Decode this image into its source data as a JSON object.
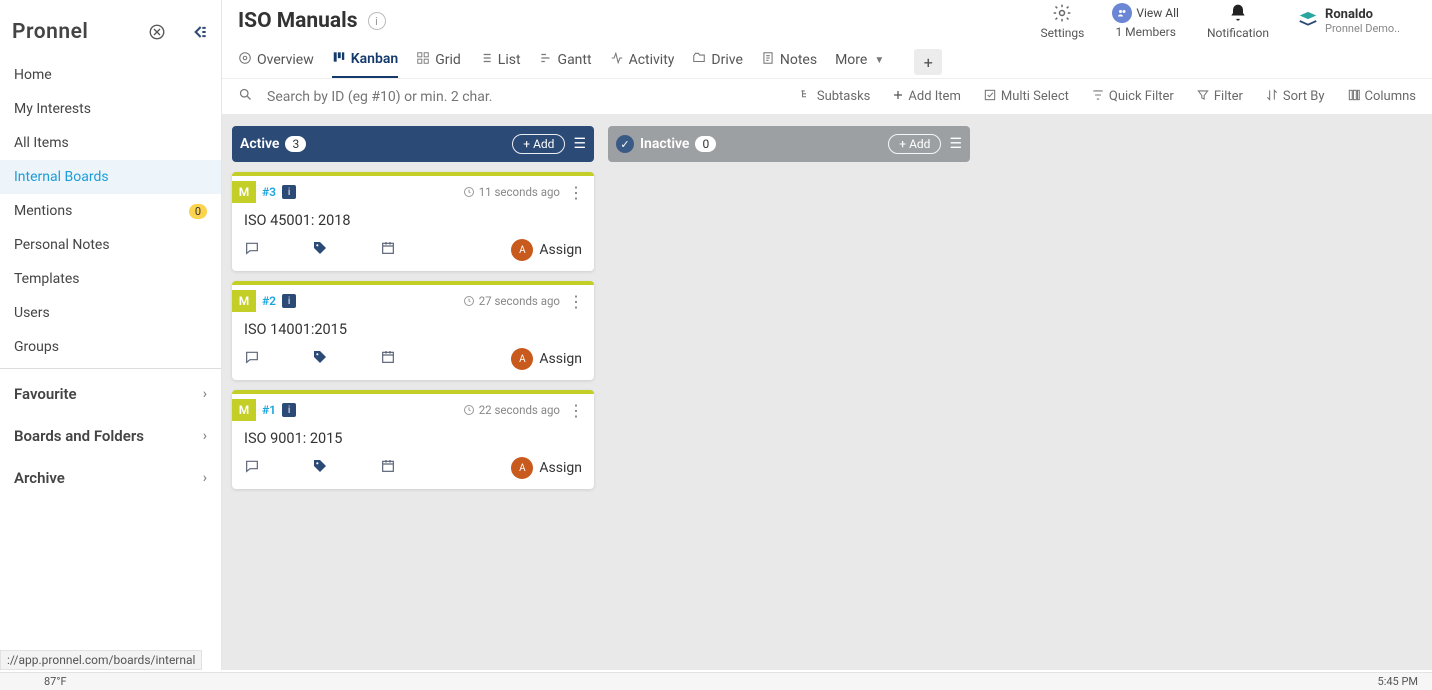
{
  "brand": "Pronnel",
  "sidebar": {
    "items": [
      {
        "label": "Home"
      },
      {
        "label": "My Interests"
      },
      {
        "label": "All Items"
      },
      {
        "label": "Internal Boards",
        "active": true
      },
      {
        "label": "Mentions",
        "badge": "0"
      },
      {
        "label": "Personal Notes"
      },
      {
        "label": "Templates"
      },
      {
        "label": "Users"
      },
      {
        "label": "Groups"
      }
    ],
    "sections": [
      {
        "label": "Favourite"
      },
      {
        "label": "Boards and Folders"
      },
      {
        "label": "Archive"
      }
    ]
  },
  "header": {
    "title": "ISO Manuals",
    "viewAll": "View All",
    "settings": "Settings",
    "members": "1 Members",
    "notification": "Notification",
    "profile": {
      "name": "Ronaldo",
      "sub": "Pronnel Demo.."
    }
  },
  "tabs": [
    {
      "label": "Overview"
    },
    {
      "label": "Kanban",
      "active": true
    },
    {
      "label": "Grid"
    },
    {
      "label": "List"
    },
    {
      "label": "Gantt"
    },
    {
      "label": "Activity"
    },
    {
      "label": "Drive"
    },
    {
      "label": "Notes"
    },
    {
      "label": "More"
    }
  ],
  "search": {
    "placeholder": "Search by ID (eg #10) or min. 2 char."
  },
  "tools": [
    {
      "label": "Subtasks"
    },
    {
      "label": "Add Item"
    },
    {
      "label": "Multi Select"
    },
    {
      "label": "Quick Filter"
    },
    {
      "label": "Filter"
    },
    {
      "label": "Sort By"
    },
    {
      "label": "Columns"
    }
  ],
  "columns": [
    {
      "name": "Active",
      "count": "3",
      "style": "blue",
      "add": "+ Add",
      "cards": [
        {
          "tag": "M",
          "id": "#3",
          "ts": "11 seconds ago",
          "title": "ISO 45001: 2018",
          "assign": "Assign"
        },
        {
          "tag": "M",
          "id": "#2",
          "ts": "27 seconds ago",
          "title": "ISO 14001:2015",
          "assign": "Assign"
        },
        {
          "tag": "M",
          "id": "#1",
          "ts": "22 seconds ago",
          "title": "ISO 9001: 2015",
          "assign": "Assign"
        }
      ]
    },
    {
      "name": "Inactive",
      "count": "0",
      "style": "gray",
      "add": "+ Add",
      "check": true,
      "cards": []
    }
  ],
  "statusUrl": "://app.pronnel.com/boards/internal",
  "taskbar": {
    "temp": "87°F",
    "time": "5:45 PM"
  }
}
